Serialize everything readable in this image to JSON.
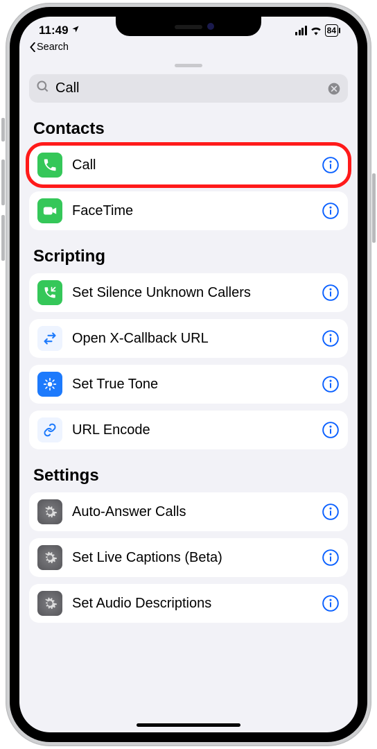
{
  "status": {
    "time": "11:49",
    "battery": "84"
  },
  "back_label": "Search",
  "search": {
    "value": "Call"
  },
  "sections": [
    {
      "title": "Contacts",
      "items": [
        {
          "label": "Call"
        },
        {
          "label": "FaceTime"
        }
      ]
    },
    {
      "title": "Scripting",
      "items": [
        {
          "label": "Set Silence Unknown Callers"
        },
        {
          "label": "Open X-Callback URL"
        },
        {
          "label": "Set True Tone"
        },
        {
          "label": "URL Encode"
        }
      ]
    },
    {
      "title": "Settings",
      "items": [
        {
          "label": "Auto-Answer Calls"
        },
        {
          "label": "Set Live Captions (Beta)"
        },
        {
          "label": "Set Audio Descriptions"
        }
      ]
    }
  ]
}
